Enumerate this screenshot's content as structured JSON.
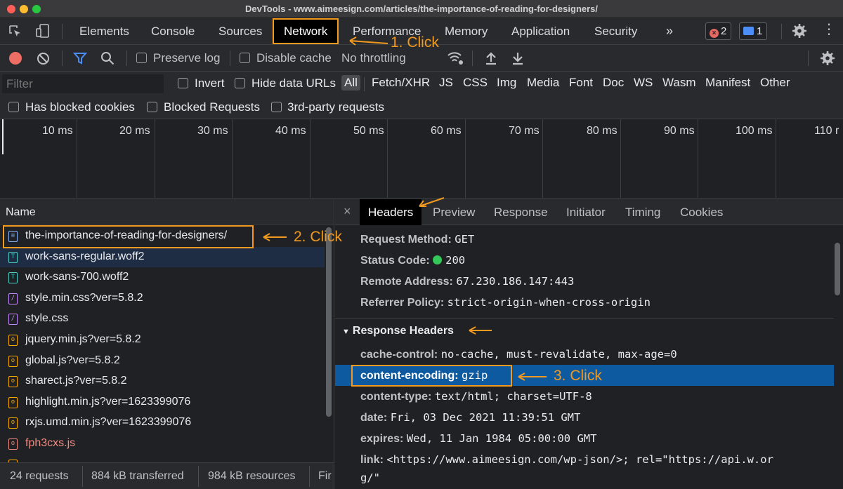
{
  "window": {
    "title": "DevTools - www.aimeesign.com/articles/the-importance-of-reading-for-designers/"
  },
  "tabs": [
    "Elements",
    "Console",
    "Sources",
    "Network",
    "Performance",
    "Memory",
    "Application",
    "Security"
  ],
  "tab_overflow": "»",
  "badges": {
    "errors": "2",
    "messages": "1"
  },
  "toolbar": {
    "preserve_log": "Preserve log",
    "disable_cache": "Disable cache",
    "throttling": "No throttling"
  },
  "filter": {
    "placeholder": "Filter",
    "invert": "Invert",
    "hide_data_urls": "Hide data URLs",
    "types": [
      "All",
      "Fetch/XHR",
      "JS",
      "CSS",
      "Img",
      "Media",
      "Font",
      "Doc",
      "WS",
      "Wasm",
      "Manifest",
      "Other"
    ],
    "has_blocked_cookies": "Has blocked cookies",
    "blocked_requests": "Blocked Requests",
    "third_party": "3rd-party requests"
  },
  "timeline": {
    "ticks": [
      "10 ms",
      "20 ms",
      "30 ms",
      "40 ms",
      "50 ms",
      "60 ms",
      "70 ms",
      "80 ms",
      "90 ms",
      "100 ms",
      "110 r"
    ]
  },
  "requests": {
    "header": "Name",
    "items": [
      {
        "name": "the-importance-of-reading-for-designers/",
        "type": "doc"
      },
      {
        "name": "work-sans-regular.woff2",
        "type": "font"
      },
      {
        "name": "work-sans-700.woff2",
        "type": "font"
      },
      {
        "name": "style.min.css?ver=5.8.2",
        "type": "css"
      },
      {
        "name": "style.css",
        "type": "css"
      },
      {
        "name": "jquery.min.js?ver=5.8.2",
        "type": "js"
      },
      {
        "name": "global.js?ver=5.8.2",
        "type": "js"
      },
      {
        "name": "sharect.js?ver=5.8.2",
        "type": "js"
      },
      {
        "name": "highlight.min.js?ver=1623399076",
        "type": "js"
      },
      {
        "name": "rxjs.umd.min.js?ver=1623399076",
        "type": "js"
      },
      {
        "name": "fph3cxs.js",
        "type": "js-error"
      }
    ]
  },
  "statusbar": {
    "requests": "24 requests",
    "transferred": "884 kB transferred",
    "resources": "984 kB resources",
    "finish": "Fir"
  },
  "detail_tabs": [
    "Headers",
    "Preview",
    "Response",
    "Initiator",
    "Timing",
    "Cookies"
  ],
  "close_glyph": "×",
  "general": [
    {
      "k": "Request Method:",
      "v": "GET"
    },
    {
      "k": "Status Code:",
      "v": "200"
    },
    {
      "k": "Remote Address:",
      "v": "67.230.186.147:443"
    },
    {
      "k": "Referrer Policy:",
      "v": "strict-origin-when-cross-origin"
    }
  ],
  "response_headers_title": "Response Headers",
  "response_headers": [
    {
      "k": "cache-control:",
      "v": "no-cache, must-revalidate, max-age=0"
    },
    {
      "k": "content-encoding:",
      "v": "gzip"
    },
    {
      "k": "content-type:",
      "v": "text/html; charset=UTF-8"
    },
    {
      "k": "date:",
      "v": "Fri, 03 Dec 2021 11:39:51 GMT"
    },
    {
      "k": "expires:",
      "v": "Wed, 11 Jan 1984 05:00:00 GMT"
    },
    {
      "k": "link:",
      "v": "<https://www.aimeesign.com/wp-json/>; rel=\"https://api.w.or"
    },
    {
      "k": "",
      "v": "g/\""
    }
  ],
  "annotations": {
    "step1": "1. Click",
    "step2": "2. Click",
    "step3": "3. Click"
  },
  "colors": {
    "accent": "#f29a1f",
    "selected_row": "#0e5aa0",
    "status_ok": "#34c759"
  }
}
